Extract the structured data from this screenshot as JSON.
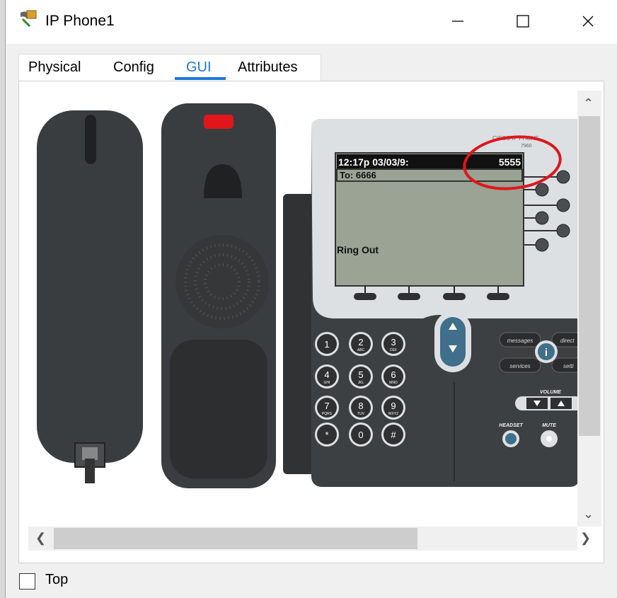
{
  "window": {
    "title": "IP Phone1",
    "minimize_label": "—",
    "maximize_label": "☐",
    "close_label": "✕"
  },
  "tabs": [
    {
      "label": "Physical",
      "active": false
    },
    {
      "label": "Config",
      "active": false
    },
    {
      "label": "GUI",
      "active": true
    },
    {
      "label": "Attributes",
      "active": false
    }
  ],
  "phone": {
    "brand": "CISCO IP PHONE",
    "model": "7960",
    "screen": {
      "datetime": "12:17p 03/03/9:",
      "extension": "5555",
      "to_line": "To: 6666",
      "status": "Ring Out"
    },
    "keypad": [
      {
        "digit": "1",
        "letters": ""
      },
      {
        "digit": "2",
        "letters": "ABC"
      },
      {
        "digit": "3",
        "letters": "DEF"
      },
      {
        "digit": "4",
        "letters": "GHI"
      },
      {
        "digit": "5",
        "letters": "JKL"
      },
      {
        "digit": "6",
        "letters": "MNO"
      },
      {
        "digit": "7",
        "letters": "PQRS"
      },
      {
        "digit": "8",
        "letters": "TUV"
      },
      {
        "digit": "9",
        "letters": "WXYZ"
      },
      {
        "digit": "*",
        "letters": ""
      },
      {
        "digit": "0",
        "letters": ""
      },
      {
        "digit": "#",
        "letters": ""
      }
    ],
    "buttons": {
      "messages": "messages",
      "directories": "direct",
      "services": "services",
      "settings": "setti",
      "info": "i",
      "volume": "VOLUME",
      "headset": "HEADSET",
      "mute": "MUTE"
    }
  },
  "footer": {
    "top_checkbox_label": "Top",
    "top_checked": false
  },
  "colors": {
    "accent": "#1a7ad6",
    "screen_bg": "#9aa394",
    "body_dark": "#3c4043",
    "highlight_circle": "#e0161b"
  }
}
